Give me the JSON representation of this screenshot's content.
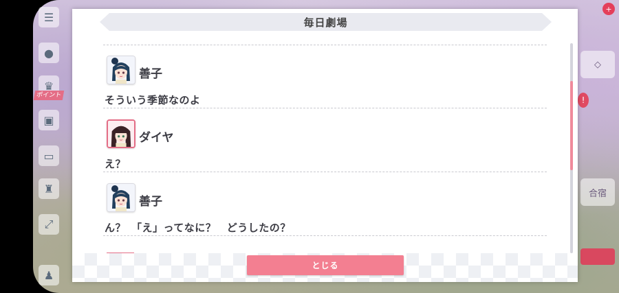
{
  "dialog": {
    "title": "毎日劇場",
    "close_label": "とじる"
  },
  "log": [
    {
      "speaker": "善子",
      "text": "そういう季節なのよ",
      "avatar": "yoshiko-avatar",
      "highlighted": false
    },
    {
      "speaker": "ダイヤ",
      "text": "え？",
      "avatar": "dia-avatar",
      "highlighted": true
    },
    {
      "speaker": "善子",
      "text": "ん？　「え」ってなに？　どうしたの？",
      "avatar": "yoshiko-avatar",
      "highlighted": false
    }
  ],
  "background": {
    "left_rail_badge": "ポイント",
    "right_rail_label": "合宿"
  },
  "colors": {
    "accent": "#f37f91",
    "scroll_thumb": "#f08a9b",
    "title_bar": "#e9eaf0",
    "text": "#3c3c44"
  }
}
